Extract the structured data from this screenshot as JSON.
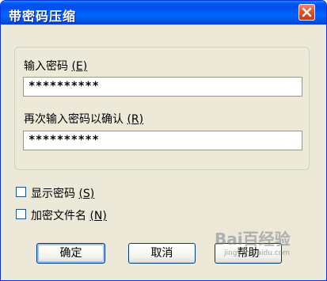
{
  "window": {
    "title": "带密码压缩"
  },
  "password": {
    "label": "输入密码",
    "label_key": "(E)",
    "value": "**********"
  },
  "confirm": {
    "label": "再次输入密码以确认",
    "label_key": "(R)",
    "value": "**********"
  },
  "options": {
    "show_password": {
      "label": "显示密码",
      "key": "(S)",
      "checked": false
    },
    "encrypt_names": {
      "label": "加密文件名",
      "key": "(N)",
      "checked": false
    }
  },
  "buttons": {
    "ok": "确定",
    "cancel": "取消",
    "help": "帮助"
  },
  "watermark": {
    "text": "Bai百经验",
    "url": "jingyan.baidu.com"
  }
}
